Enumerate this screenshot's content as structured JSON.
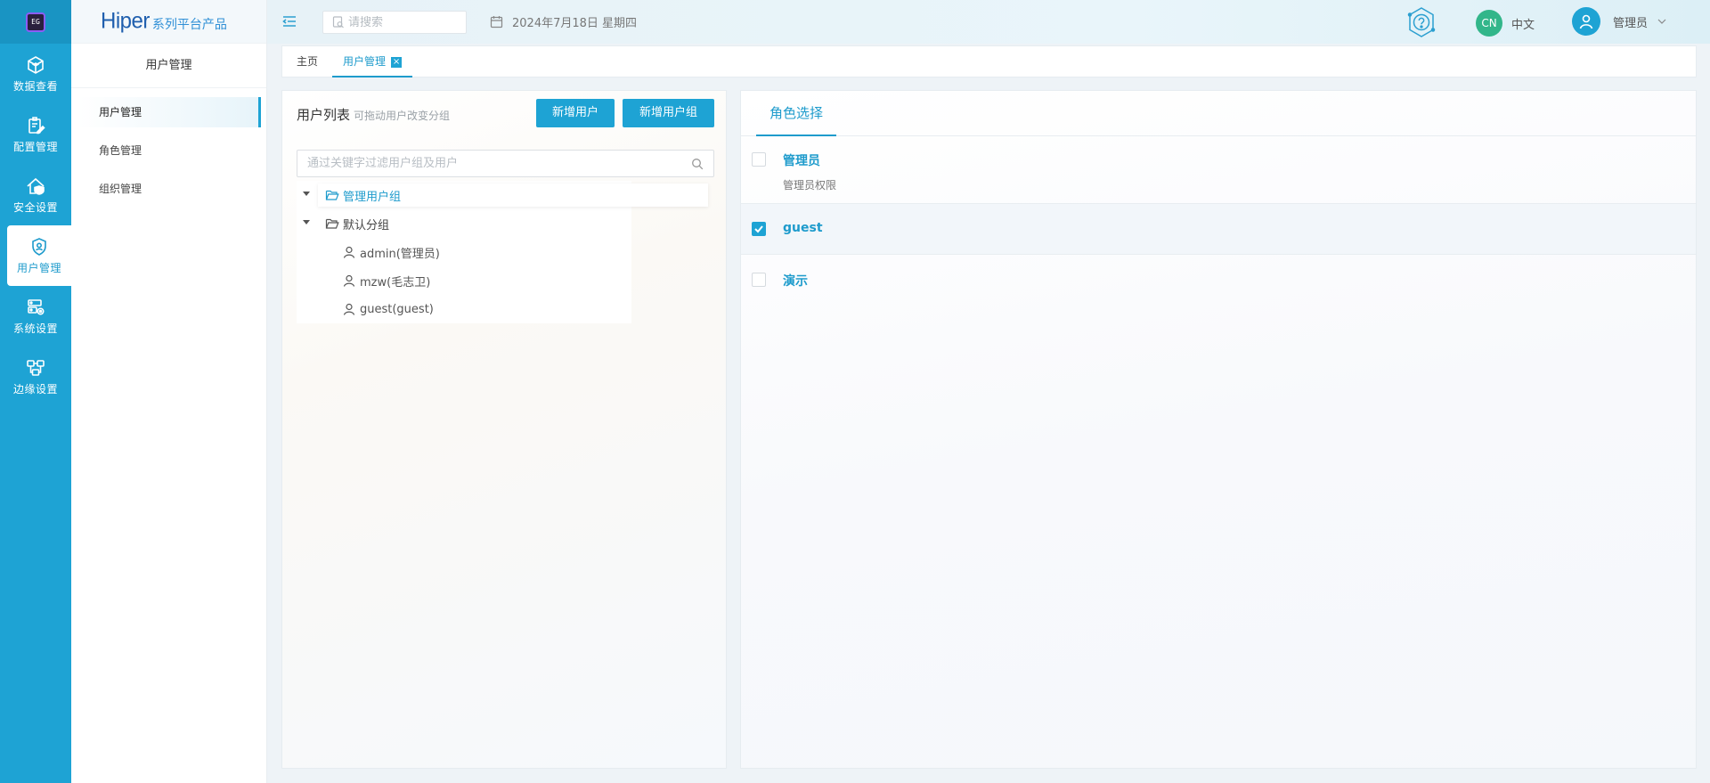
{
  "brand": {
    "main": "Hiper",
    "sub": "系列平台产品"
  },
  "rail": {
    "logo_text": "EG",
    "items": [
      {
        "label": "数据查看",
        "icon": "cube-icon"
      },
      {
        "label": "配置管理",
        "icon": "clipboard-edit-icon"
      },
      {
        "label": "安全设置",
        "icon": "home-shield-icon"
      },
      {
        "label": "用户管理",
        "icon": "shield-user-icon",
        "active": true
      },
      {
        "label": "系统设置",
        "icon": "server-gear-icon"
      },
      {
        "label": "边缘设置",
        "icon": "nodes-icon"
      }
    ]
  },
  "subnav": {
    "title": "用户管理",
    "items": [
      {
        "label": "用户管理",
        "active": true
      },
      {
        "label": "角色管理"
      },
      {
        "label": "组织管理"
      }
    ]
  },
  "header": {
    "search_placeholder": "请搜索",
    "date": "2024年7月18日 星期四",
    "lang_code": "CN",
    "lang_label": "中文",
    "user_name": "管理员"
  },
  "tabs": {
    "home": "主页",
    "current": "用户管理",
    "close_symbol": "×"
  },
  "user_list": {
    "title": "用户列表",
    "hint": "可拖动用户改变分组",
    "add_user": "新增用户",
    "add_group": "新增用户组",
    "filter_placeholder": "通过关键字过滤用户组及用户",
    "tree": {
      "groups": [
        {
          "label": "管理用户组",
          "selected": true
        },
        {
          "label": "默认分组"
        }
      ],
      "users": [
        "admin(管理员)",
        "mzw(毛志卫)",
        "guest(guest)"
      ]
    }
  },
  "roles": {
    "tab": "角色选择",
    "items": [
      {
        "name": "管理员",
        "desc": "管理员权限",
        "checked": false
      },
      {
        "name": "guest",
        "desc": "",
        "checked": true
      },
      {
        "name": "演示",
        "desc": "",
        "checked": false
      }
    ]
  },
  "colors": {
    "primary": "#1ea3d4",
    "rail": "#1ea3d4",
    "lang_badge": "#32b68a"
  }
}
